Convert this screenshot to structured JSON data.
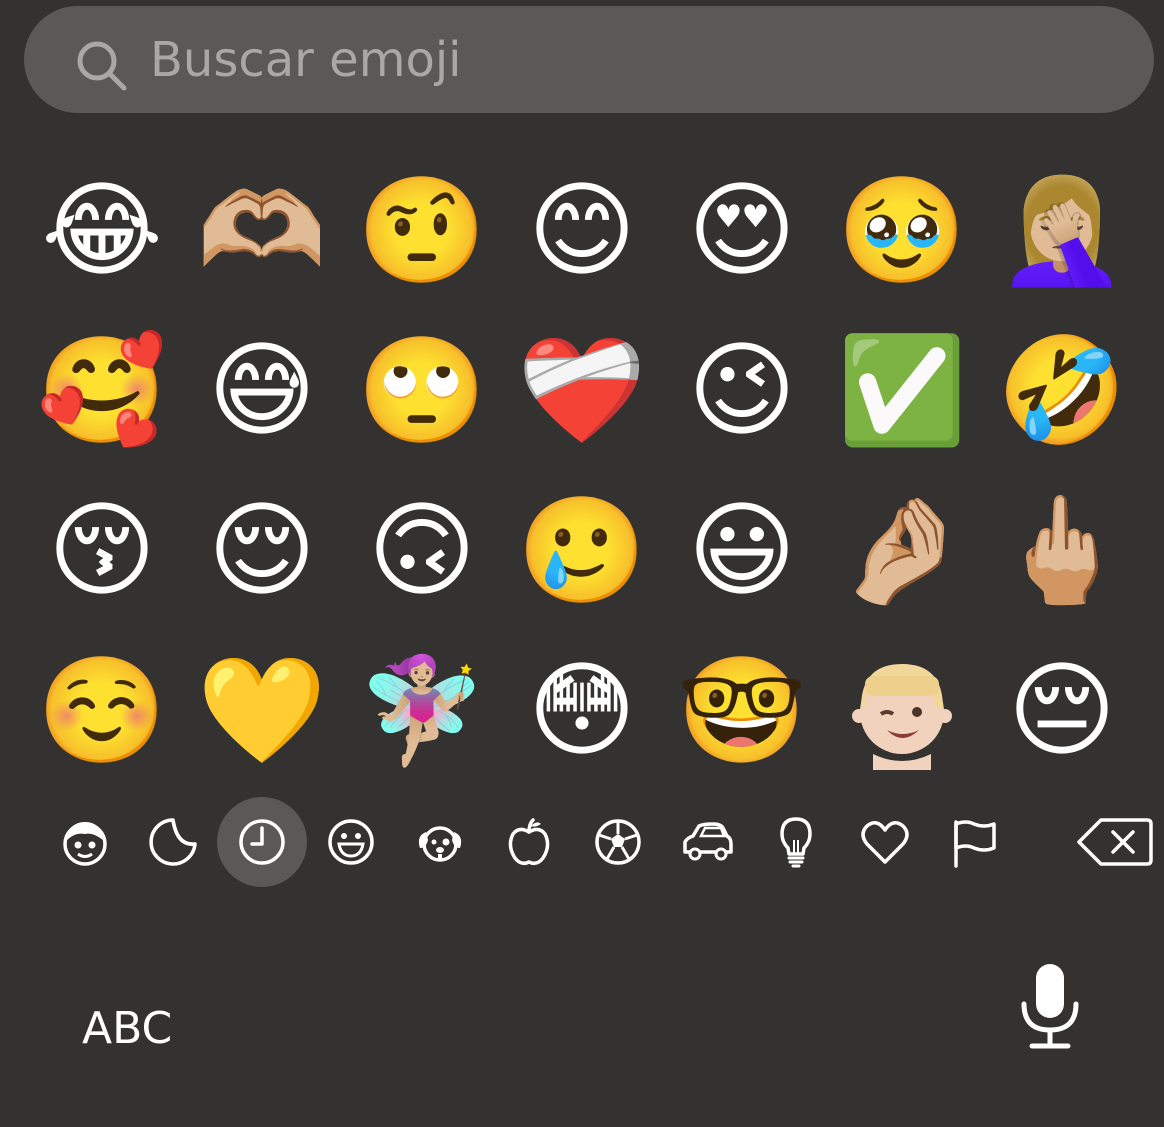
{
  "search": {
    "placeholder": "Buscar emoji",
    "icon": "search-icon"
  },
  "emoji_grid": {
    "rows": [
      [
        "😂",
        "🫶🏼",
        "🤨",
        "😊",
        "😍",
        "🥹",
        "🤦🏼‍♀️"
      ],
      [
        "🥰",
        "😅",
        "🙄",
        "❤️‍🩹",
        "😉",
        "✅",
        "🤣"
      ],
      [
        "😚",
        "😌",
        "🙃",
        "🥲",
        "😃",
        "🤌🏼",
        "🖕🏼"
      ],
      [
        "☺️",
        "💛",
        "🧚🏼‍♀️",
        "😳",
        "🤓",
        "memoji-winking",
        "😔"
      ]
    ]
  },
  "categories": [
    {
      "name": "memoji-icon",
      "active": false
    },
    {
      "name": "sticker-icon",
      "active": false
    },
    {
      "name": "recent-clock-icon",
      "active": true
    },
    {
      "name": "smileys-icon",
      "active": false
    },
    {
      "name": "animals-icon",
      "active": false
    },
    {
      "name": "food-icon",
      "active": false
    },
    {
      "name": "activity-icon",
      "active": false
    },
    {
      "name": "travel-icon",
      "active": false
    },
    {
      "name": "objects-icon",
      "active": false
    },
    {
      "name": "symbols-icon",
      "active": false
    },
    {
      "name": "flags-icon",
      "active": false
    },
    {
      "name": "delete-icon",
      "active": false
    }
  ],
  "bottom": {
    "abc_label": "ABC",
    "mic_icon": "microphone-icon"
  }
}
